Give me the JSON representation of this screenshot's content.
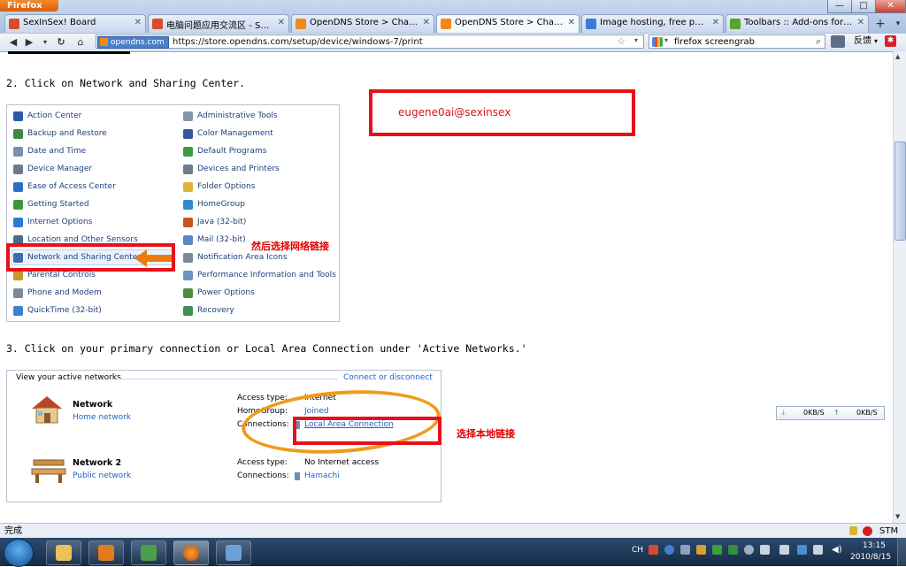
{
  "browser": {
    "menu_label": "Firefox",
    "window_buttons": {
      "minimize": "—",
      "maximize": "□",
      "close": "✕"
    },
    "tabs": [
      {
        "label": "SexInSex! Board",
        "color": "#d94b2b"
      },
      {
        "label": "电脑问题应用交流区 - SexIn...",
        "color": "#d94b2b"
      },
      {
        "label": "OpenDNS Store > Change y...",
        "color": "#f08a18"
      },
      {
        "label": "OpenDNS Store > Change y...",
        "color": "#f08a18"
      },
      {
        "label": "Image hosting, free photo s...",
        "color": "#3b7bd1"
      },
      {
        "label": "Toolbars :: Add-ons for Fire...",
        "color": "#5aa22a"
      }
    ],
    "new_tab": "+",
    "site_identity": "opendns.com",
    "url": "https://store.opendns.com/setup/device/windows-7/print",
    "search_text": "firefox screengrab",
    "feedback_label": "反馈",
    "status_text": "完成",
    "status_right": "STM"
  },
  "page": {
    "step2": "2. Click on Network and Sharing Center.",
    "step3": "3. Click on your primary connection or Local Area Connection under 'Active Networks.'",
    "email_annotation": "eugene0ai@sexinsex",
    "annotation_nsc": "然后选择网络链接",
    "annotation_lac": "选择本地链接",
    "control_panel": {
      "left": [
        {
          "label": "Action Center",
          "color": "#2d5aa8"
        },
        {
          "label": "Backup and Restore",
          "color": "#3a8b3a"
        },
        {
          "label": "Date and Time",
          "color": "#7a8fae"
        },
        {
          "label": "Device Manager",
          "color": "#6c7b90"
        },
        {
          "label": "Ease of Access Center",
          "color": "#2a70c8"
        },
        {
          "label": "Getting Started",
          "color": "#3a9a3a"
        },
        {
          "label": "Internet Options",
          "color": "#2b7bd6"
        },
        {
          "label": "Location and Other Sensors",
          "color": "#4d6b8a"
        },
        {
          "label": "Network and Sharing Center",
          "color": "#3c6bb0"
        },
        {
          "label": "Parental Controls",
          "color": "#c9952a"
        },
        {
          "label": "Phone and Modem",
          "color": "#7d8a99"
        },
        {
          "label": "QuickTime (32-bit)",
          "color": "#3e7fd0"
        }
      ],
      "right": [
        {
          "label": "Administrative Tools",
          "color": "#8396ad"
        },
        {
          "label": "Color Management",
          "color": "#3257a0"
        },
        {
          "label": "Default Programs",
          "color": "#3f9b3f"
        },
        {
          "label": "Devices and Printers",
          "color": "#6e7c8f"
        },
        {
          "label": "Folder Options",
          "color": "#e0b23a"
        },
        {
          "label": "HomeGroup",
          "color": "#2f8bd4"
        },
        {
          "label": "Java (32-bit)",
          "color": "#c7541f"
        },
        {
          "label": "Mail (32-bit)",
          "color": "#5a88c2"
        },
        {
          "label": "Notification Area Icons",
          "color": "#7b8898"
        },
        {
          "label": "Performance Information and Tools",
          "color": "#6b93c4"
        },
        {
          "label": "Power Options",
          "color": "#4c8c3c"
        },
        {
          "label": "Recovery",
          "color": "#3f8f56"
        }
      ]
    },
    "networks": {
      "header": "View your active networks",
      "connect_link": "Connect or disconnect",
      "net1": {
        "name": "Network",
        "type": "Home network",
        "access_type_label": "Access type:",
        "access_type_value": "Internet",
        "homegroup_label": "HomeGroup:",
        "homegroup_value": "Joined",
        "connections_label": "Connections:",
        "connections_value": "Local Area Connection"
      },
      "net2": {
        "name": "Network 2",
        "type": "Public network",
        "access_type_label": "Access type:",
        "access_type_value": "No Internet access",
        "connections_label": "Connections:",
        "connections_value": "Hamachi"
      }
    },
    "speed": {
      "down": "0KB/S",
      "up": "0KB/S"
    }
  },
  "taskbar": {
    "lang": "CH",
    "time": "13:15",
    "date": "2010/8/15"
  }
}
